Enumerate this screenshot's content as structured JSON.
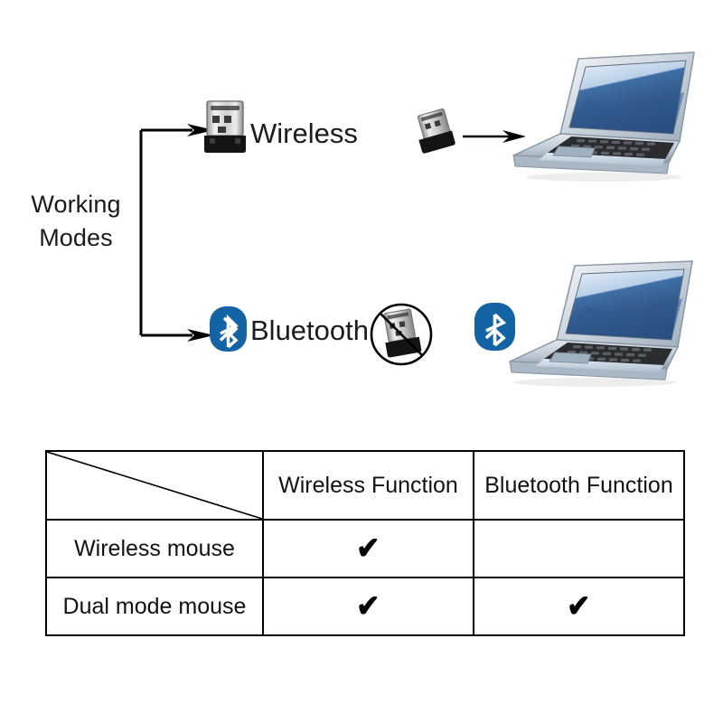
{
  "diagram": {
    "title": "Working Modes",
    "title_lines": [
      "Working",
      "Modes"
    ],
    "modes": [
      {
        "label": "Wireless",
        "icon": "usb-dongle-icon",
        "device_icon": "usb-dongle-icon",
        "device_state": "allowed",
        "target": "laptop-icon"
      },
      {
        "label": "Bluetooth",
        "icon": "bluetooth-icon",
        "device_icon": "usb-dongle-blocked-icon",
        "device_state": "blocked",
        "target": "laptop-icon"
      }
    ]
  },
  "colors": {
    "bluetooth_blue": "#1464a5",
    "bluetooth_blue_dark": "#0f4f86",
    "laptop_screen_light": "#d9e7f5",
    "laptop_screen_dark": "#2f5b92",
    "laptop_body": "#c3ccd6",
    "line": "#000000",
    "background": "#ffffff"
  },
  "table": {
    "corner_label": "",
    "columns": [
      "Wireless Function",
      "Bluetooth Function"
    ],
    "rows": [
      {
        "label": "Wireless mouse",
        "cells": [
          "✔",
          ""
        ]
      },
      {
        "label": "Dual mode mouse",
        "cells": [
          "✔",
          "✔"
        ]
      }
    ]
  }
}
